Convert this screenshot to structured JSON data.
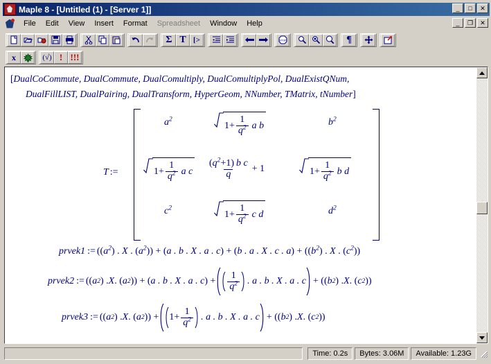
{
  "window": {
    "app_name": "Maple 8",
    "title": "Maple 8  - [Untitled (1) - [Server 1]]",
    "minimize_label": "_",
    "maximize_label": "□",
    "close_label": "✕",
    "mdi_minimize_label": "_",
    "mdi_restore_label": "❐",
    "mdi_close_label": "✕",
    "icon": "maple-leaf-icon"
  },
  "menubar": {
    "items": [
      {
        "label": "File",
        "disabled": false
      },
      {
        "label": "Edit",
        "disabled": false
      },
      {
        "label": "View",
        "disabled": false
      },
      {
        "label": "Insert",
        "disabled": false
      },
      {
        "label": "Format",
        "disabled": false
      },
      {
        "label": "Spreadsheet",
        "disabled": true
      },
      {
        "label": "Window",
        "disabled": false
      },
      {
        "label": "Help",
        "disabled": false
      }
    ]
  },
  "toolbar_main": {
    "groups": [
      {
        "buttons": [
          {
            "name": "new-document-icon",
            "tip": "New"
          },
          {
            "name": "open-folder-icon",
            "tip": "Open"
          },
          {
            "name": "open-url-icon",
            "tip": "Open URL"
          },
          {
            "name": "save-disk-icon",
            "tip": "Save"
          },
          {
            "name": "print-icon",
            "tip": "Print"
          }
        ]
      },
      {
        "buttons": [
          {
            "name": "cut-scissors-icon",
            "tip": "Cut"
          },
          {
            "name": "copy-icon",
            "tip": "Copy"
          },
          {
            "name": "paste-icon",
            "tip": "Paste"
          }
        ]
      },
      {
        "buttons": [
          {
            "name": "undo-arrow-icon",
            "tip": "Undo"
          },
          {
            "name": "redo-arrow-icon",
            "tip": "Redo"
          }
        ]
      },
      {
        "buttons": [
          {
            "name": "sigma-math-icon",
            "label": "Σ",
            "tip": "Math input"
          },
          {
            "name": "text-t-icon",
            "label": "T",
            "tip": "Text input"
          },
          {
            "name": "prompt-icon",
            "label": "[>",
            "tip": "Insert prompt"
          }
        ]
      },
      {
        "buttons": [
          {
            "name": "outdent-icon",
            "tip": "Outdent"
          },
          {
            "name": "indent-icon",
            "tip": "Indent"
          }
        ]
      },
      {
        "buttons": [
          {
            "name": "back-arrow-icon",
            "tip": "Back"
          },
          {
            "name": "forward-arrow-icon",
            "tip": "Forward"
          }
        ]
      },
      {
        "buttons": [
          {
            "name": "stop-sign-icon",
            "label": "STOP",
            "tip": "Stop"
          }
        ]
      },
      {
        "buttons": [
          {
            "name": "zoom-out-icon",
            "tip": "Zoom out"
          },
          {
            "name": "zoom-reset-icon",
            "tip": "Zoom 100%"
          },
          {
            "name": "zoom-in-icon",
            "tip": "Zoom in"
          }
        ]
      },
      {
        "buttons": [
          {
            "name": "pilcrow-icon",
            "label": "¶",
            "tip": "Show nonprintables"
          }
        ]
      },
      {
        "buttons": [
          {
            "name": "move-cross-icon",
            "tip": "Pan"
          }
        ]
      },
      {
        "buttons": [
          {
            "name": "restart-icon",
            "tip": "Restart"
          }
        ]
      }
    ]
  },
  "toolbar_secondary": {
    "groups": [
      {
        "buttons": [
          {
            "name": "variable-x-icon",
            "label": "x",
            "tip": "Variable"
          },
          {
            "name": "maple-leaf-icon",
            "tip": "Maple"
          }
        ]
      },
      {
        "buttons": [
          {
            "name": "execute-check-icon",
            "label": "(√)",
            "tip": "Execute"
          },
          {
            "name": "execute-single-icon",
            "label": "!",
            "tip": "Execute line"
          },
          {
            "name": "execute-all-icon",
            "label": "!!!",
            "tip": "Execute worksheet"
          }
        ]
      }
    ]
  },
  "document": {
    "package_list": {
      "open_bracket": "[",
      "close_bracket": "]",
      "line1": "DualCoCommute, DualCommute, DualComultiply, DualComultiplyPol, DualExistQNum,",
      "line2": "DualFillLIST, DualPairing, DualTransform, HyperGeom, NNumber, TMatrix, tNumber",
      "names": [
        "DualCoCommute",
        "DualCommute",
        "DualComultiply",
        "DualComultiplyPol",
        "DualExistQNum",
        "DualFillLIST",
        "DualPairing",
        "DualTransform",
        "HyperGeom",
        "NNumber",
        "TMatrix",
        "tNumber"
      ]
    },
    "matrix": {
      "label": "T",
      "assign_op": ":=",
      "one": "1",
      "q": "q",
      "two": "2",
      "plus": "+",
      "cells": [
        [
          {
            "kind": "power",
            "base": "a",
            "exp": "2"
          },
          {
            "kind": "sqrt_prod",
            "vars": "a b"
          },
          {
            "kind": "power",
            "base": "b",
            "exp": "2"
          }
        ],
        [
          {
            "kind": "sqrt_prod",
            "vars": "a c"
          },
          {
            "kind": "fraction_plus_one",
            "num": "(q2 + 1) b c",
            "den": "q",
            "tail": "+ 1"
          },
          {
            "kind": "sqrt_prod",
            "vars": "b d"
          }
        ],
        [
          {
            "kind": "power",
            "base": "c",
            "exp": "2"
          },
          {
            "kind": "sqrt_prod",
            "vars": "c d"
          },
          {
            "kind": "power",
            "base": "d",
            "exp": "2"
          }
        ]
      ],
      "cell_texts": [
        [
          "a^2",
          "sqrt(1+1/q^2) a b",
          "b^2"
        ],
        [
          "sqrt(1+1/q^2) a c",
          "((q^2+1) b c)/q + 1",
          "sqrt(1+1/q^2) b d"
        ],
        [
          "c^2",
          "sqrt(1+1/q^2) c d",
          "d^2"
        ]
      ]
    },
    "results": [
      {
        "name": "prvek1",
        "assign_op": ":=",
        "text": "prvek1 := ((a^2) . X . (a^2)) + (a . b . X . a . c) + (b . a . X . c . a) + ((b^2) . X . (c^2))"
      },
      {
        "name": "prvek2",
        "assign_op": ":=",
        "text": "prvek2 := ((a^2) . X . (a^2)) + (a . b . X . a . c) + ((1/q^2) . a . b . X . a . c) + ((b^2) . X . (c^2))"
      },
      {
        "name": "prvek3",
        "assign_op": ":=",
        "text": "prvek3 := ((a^2) . X . (a^2)) + ((1 + 1/q^2) . a . b . X . a . c) + ((b^2) . X . (c^2))"
      }
    ],
    "symbols": {
      "X": "X",
      "dot": ".",
      "plus": "+",
      "one": "1",
      "q": "q",
      "two": "2",
      "lparen": "(",
      "rparen": ")"
    }
  },
  "scrollbar": {
    "up_arrow": "▲",
    "down_arrow": "▼",
    "thumb_position_percent": 52
  },
  "statusbar": {
    "time": "Time:   0.2s",
    "bytes": "Bytes: 3.06M",
    "available": "Available: 1.23G"
  },
  "colors": {
    "titlebar_start": "#0a246a",
    "titlebar_end": "#3a6ea5",
    "window_face": "#d4d0c8",
    "math_text": "#000080",
    "page_background": "#ffffff",
    "disabled_text": "#808080"
  }
}
